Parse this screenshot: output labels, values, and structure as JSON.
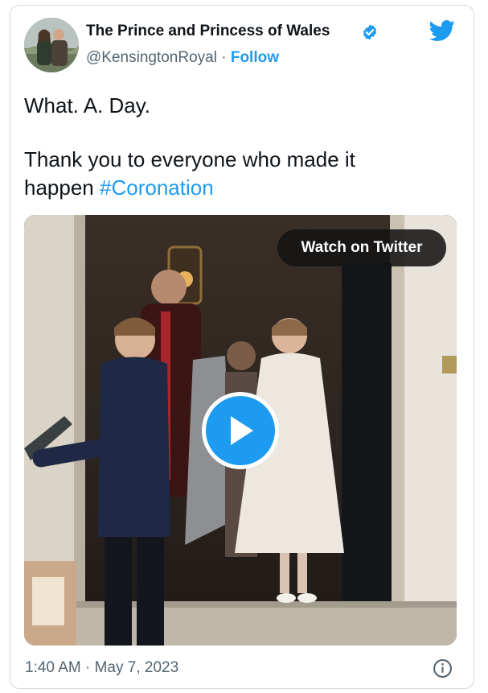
{
  "author": {
    "display_name": "The Prince and Princess of Wales",
    "handle": "@KensingtonRoyal",
    "separator": "·",
    "follow_label": "Follow",
    "verified": true
  },
  "tweet": {
    "line1": "What. A. Day.",
    "line2": "Thank you to everyone who made it",
    "line3_prefix": "happen",
    "hashtag": "#Coronation"
  },
  "media": {
    "watch_label": "Watch on Twitter"
  },
  "footer": {
    "time": "1:40 AM",
    "separator": "·",
    "date": "May 7, 2023"
  },
  "colors": {
    "accent": "#1d9bf0",
    "text": "#0f1419",
    "secondary": "#536471"
  },
  "icons": [
    "twitter-bird-icon",
    "verified-badge-icon",
    "play-icon",
    "info-icon"
  ]
}
